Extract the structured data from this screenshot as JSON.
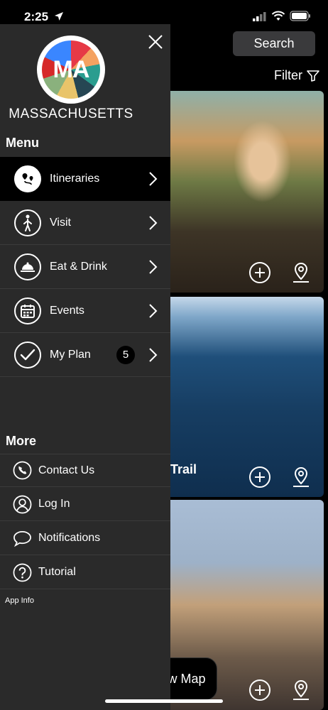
{
  "status": {
    "time": "2:25"
  },
  "header": {
    "search_label": "Search",
    "filter_label": "Filter"
  },
  "cards": [
    {
      "title": ""
    },
    {
      "title": "Trail"
    },
    {
      "title": ""
    }
  ],
  "map_button_label": "w Map",
  "drawer": {
    "brand": "MASSACHUSETTS",
    "logo_text": "MA",
    "menu_heading": "Menu",
    "menu_items": [
      {
        "label": "Itineraries",
        "icon": "itinerary-icon",
        "active": true
      },
      {
        "label": "Visit",
        "icon": "walking-person-icon"
      },
      {
        "label": "Eat & Drink",
        "icon": "food-cloche-icon"
      },
      {
        "label": "Events",
        "icon": "calendar-icon"
      },
      {
        "label": "My Plan",
        "icon": "checkmark-icon",
        "badge": "5"
      }
    ],
    "more_heading": "More",
    "more_items": [
      {
        "label": "Contact Us",
        "icon": "phone-icon"
      },
      {
        "label": "Log In",
        "icon": "user-icon"
      },
      {
        "label": "Notifications",
        "icon": "speech-bubble-icon"
      },
      {
        "label": "Tutorial",
        "icon": "question-icon"
      }
    ],
    "app_info": "App Info"
  }
}
